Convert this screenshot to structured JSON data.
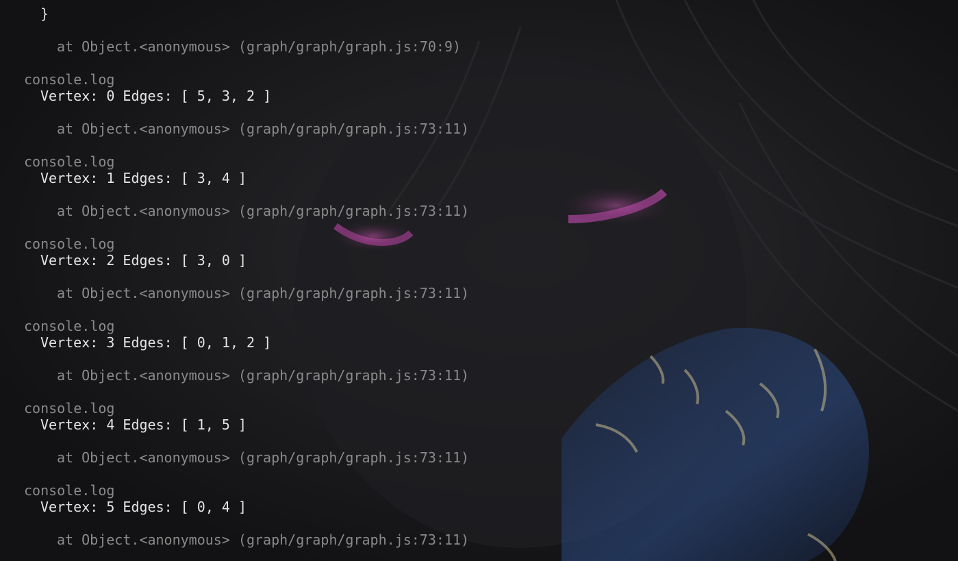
{
  "terminal": {
    "closing_brace": "}",
    "first_trace": "at Object.<anonymous> (graph/graph/graph.js:70:9)",
    "entries": [
      {
        "label": "console.log",
        "message": "Vertex: 0 Edges: [ 5, 3, 2 ]",
        "trace": "at Object.<anonymous> (graph/graph/graph.js:73:11)"
      },
      {
        "label": "console.log",
        "message": "Vertex: 1 Edges: [ 3, 4 ]",
        "trace": "at Object.<anonymous> (graph/graph/graph.js:73:11)"
      },
      {
        "label": "console.log",
        "message": "Vertex: 2 Edges: [ 3, 0 ]",
        "trace": "at Object.<anonymous> (graph/graph/graph.js:73:11)"
      },
      {
        "label": "console.log",
        "message": "Vertex: 3 Edges: [ 0, 1, 2 ]",
        "trace": "at Object.<anonymous> (graph/graph/graph.js:73:11)"
      },
      {
        "label": "console.log",
        "message": "Vertex: 4 Edges: [ 1, 5 ]",
        "trace": "at Object.<anonymous> (graph/graph/graph.js:73:11)"
      },
      {
        "label": "console.log",
        "message": "Vertex: 5 Edges: [ 0, 4 ]",
        "trace": "at Object.<anonymous> (graph/graph/graph.js:73:11)"
      }
    ]
  },
  "colors": {
    "background": "#141416",
    "text_primary": "#e4e4e4",
    "text_muted": "#8a8a8a",
    "wallpaper_eye": "#b0489c",
    "wallpaper_glove": "#2e4f8c"
  },
  "icons": {
    "wallpaper": "anime-character-wallpaper"
  }
}
